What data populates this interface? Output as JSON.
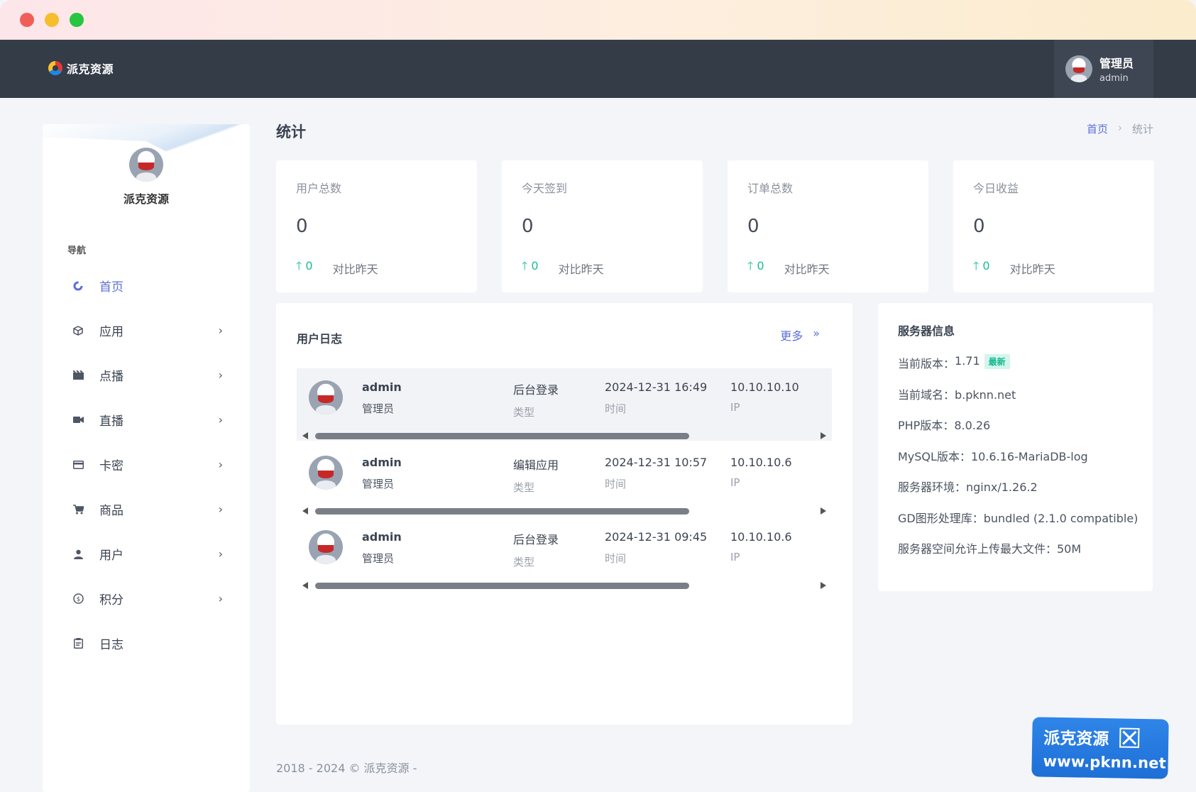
{
  "window": {
    "controls": [
      "close",
      "minimize",
      "maximize"
    ]
  },
  "topbar": {
    "brand_name": "派克资源",
    "user_display": "管理员",
    "user_login": "admin"
  },
  "sidebar": {
    "brand_name": "派克资源",
    "nav_heading": "导航",
    "items": [
      {
        "label": "首页",
        "icon": "dashboard-icon",
        "active": true,
        "has_children": false
      },
      {
        "label": "应用",
        "icon": "cube-icon",
        "has_children": true
      },
      {
        "label": "点播",
        "icon": "film-icon",
        "has_children": true
      },
      {
        "label": "直播",
        "icon": "video-camera-icon",
        "has_children": true
      },
      {
        "label": "卡密",
        "icon": "card-icon",
        "has_children": true
      },
      {
        "label": "商品",
        "icon": "cart-icon",
        "has_children": true
      },
      {
        "label": "用户",
        "icon": "user-icon",
        "has_children": true
      },
      {
        "label": "积分",
        "icon": "coin-icon",
        "has_children": true
      },
      {
        "label": "日志",
        "icon": "clipboard-icon",
        "has_children": false
      }
    ]
  },
  "page": {
    "title": "统计",
    "breadcrumb": {
      "home": "首页",
      "separator": "›",
      "current": "统计"
    }
  },
  "stats": [
    {
      "title": "用户总数",
      "value": "0",
      "delta": "0",
      "compare": "对比昨天"
    },
    {
      "title": "今天签到",
      "value": "0",
      "delta": "0",
      "compare": "对比昨天"
    },
    {
      "title": "订单总数",
      "value": "0",
      "delta": "0",
      "compare": "对比昨天"
    },
    {
      "title": "今日收益",
      "value": "0",
      "delta": "0",
      "compare": "对比昨天"
    }
  ],
  "logs": {
    "title": "用户日志",
    "more": "更多",
    "more_icon": "»",
    "rows": [
      {
        "user": "admin",
        "role": "管理员",
        "type": "后台登录",
        "type_label": "类型",
        "time": "2024-12-31 16:49",
        "time_label": "时间",
        "ip": "10.10.10.10",
        "ip_label": "IP"
      },
      {
        "user": "admin",
        "role": "管理员",
        "type": "编辑应用",
        "type_label": "类型",
        "time": "2024-12-31 10:57",
        "time_label": "时间",
        "ip": "10.10.10.6",
        "ip_label": "IP"
      },
      {
        "user": "admin",
        "role": "管理员",
        "type": "后台登录",
        "type_label": "类型",
        "time": "2024-12-31 09:45",
        "time_label": "时间",
        "ip": "10.10.10.6",
        "ip_label": "IP"
      }
    ]
  },
  "server": {
    "title": "服务器信息",
    "version_label": "当前版本：",
    "version": "1.71",
    "version_badge": "最新",
    "items": [
      "当前域名：b.pknn.net",
      "PHP版本：8.0.26",
      "MySQL版本：10.6.16-MariaDB-log",
      "服务器环境：nginx/1.26.2",
      "GD图形处理库：bundled (2.1.0 compatible)",
      "服务器空间允许上传最大文件：50M"
    ]
  },
  "footer": {
    "text": "2018 - 2024 © 派克资源 -"
  },
  "watermark": {
    "name": "派克资源",
    "url": "www.pknn.net"
  },
  "colors": {
    "topbar": "#343c48",
    "accent": "#5b6fd8",
    "up": "#1bbc9b"
  }
}
